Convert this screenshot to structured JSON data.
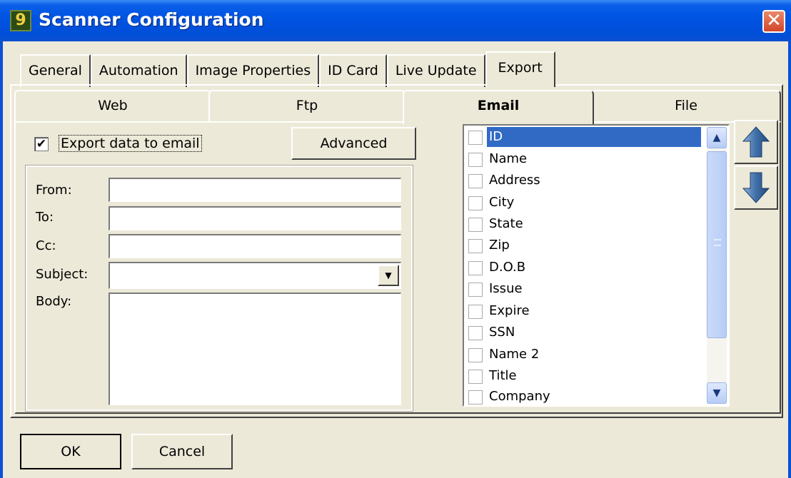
{
  "window": {
    "title": "Scanner Configuration",
    "close_glyph": "✕",
    "icon_glyph": "9"
  },
  "top_tabs": [
    {
      "label": "General"
    },
    {
      "label": "Automation"
    },
    {
      "label": "Image Properties"
    },
    {
      "label": "ID Card"
    },
    {
      "label": "Live Update"
    },
    {
      "label": "Export"
    }
  ],
  "active_top_tab": "Export",
  "sub_tabs": [
    {
      "label": "Web"
    },
    {
      "label": "Ftp"
    },
    {
      "label": "Email"
    },
    {
      "label": "File"
    }
  ],
  "active_sub_tab": "Email",
  "email": {
    "export_checkbox": {
      "label": "Export data to email",
      "checked": true,
      "check_glyph": "✔"
    },
    "advanced_label": "Advanced",
    "from_label": "From:",
    "from_value": "",
    "to_label": "To:",
    "to_value": "",
    "cc_label": "Cc:",
    "cc_value": "",
    "subject_label": "Subject:",
    "subject_value": "",
    "body_label": "Body:",
    "body_value": ""
  },
  "fields_list": {
    "items": [
      "ID",
      "Name",
      "Address",
      "City",
      "State",
      "Zip",
      "D.O.B",
      "Issue",
      "Expire",
      "SSN",
      "Name 2",
      "Title",
      "Company"
    ],
    "selected": "ID",
    "scroll_up_glyph": "▲",
    "scroll_down_glyph": "▼"
  },
  "footer": {
    "ok_label": "OK",
    "cancel_label": "Cancel"
  }
}
